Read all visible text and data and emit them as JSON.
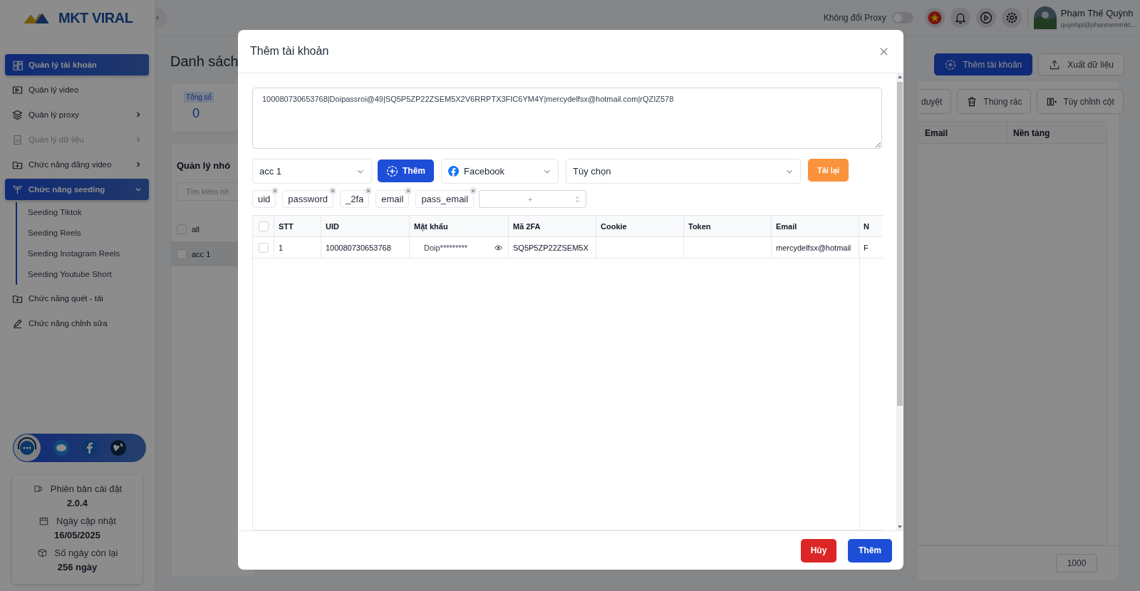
{
  "app": {
    "logo": "MKT VIRAL"
  },
  "sidebar": {
    "items": [
      {
        "label": "Quản lý tài khoản",
        "selected": true,
        "disabled": false
      },
      {
        "label": "Quản lý video",
        "selected": false,
        "disabled": false
      },
      {
        "label": "Quản lý proxy",
        "selected": false,
        "disabled": false,
        "expanded": false
      },
      {
        "label": "Quản lý dữ liệu",
        "selected": false,
        "disabled": true,
        "expanded": false
      },
      {
        "label": "Chức năng đăng video",
        "selected": false,
        "disabled": false,
        "expanded": false
      },
      {
        "label": "Chức năng seeding",
        "selected": true,
        "disabled": false,
        "expanded": true,
        "children": [
          {
            "label": "Seeding Tiktok",
            "selected": false
          },
          {
            "label": "Seeding Reels",
            "selected": false
          },
          {
            "label": "Seeding Instagram Reels",
            "selected": false
          },
          {
            "label": "Seeding Youtube Short",
            "selected": false
          }
        ]
      },
      {
        "label": "Chức năng quét - tải",
        "selected": false,
        "disabled": false
      },
      {
        "label": "Chức năng chỉnh sửa",
        "selected": false,
        "disabled": false
      }
    ],
    "install_info": [
      {
        "label": "Phiên bản cài đặt",
        "value": "2.0.4"
      },
      {
        "label": "Ngày cập nhật",
        "value": "16/05/2025"
      },
      {
        "label": "Số ngày còn lại",
        "value": "256 ngày"
      }
    ]
  },
  "header": {
    "proxy_toggle": {
      "label": "Không đổi Proxy",
      "on": false
    },
    "user": {
      "name": "Phạm Thế Quỳnh",
      "email": "quynhpt@phanmemmkt...."
    }
  },
  "page": {
    "title": "Danh sách",
    "total": {
      "label": "Tổng số",
      "value": "0"
    },
    "groups": {
      "title": "Quản lý nhó",
      "search": {
        "placeholder": "Tìm kiếm nh"
      },
      "items": [
        {
          "label": "all",
          "selected": false,
          "checked": false
        },
        {
          "label": "acc 1",
          "selected": true,
          "checked": false
        }
      ]
    },
    "actions": [
      "Thêm tài khoản",
      "Xuất dữ liệu"
    ],
    "toolbar": [
      "duyệt",
      "Thùng rác",
      "Tùy chỉnh cột"
    ],
    "columns": [
      "Email",
      "Nền tảng"
    ],
    "page_size": "1000"
  },
  "modal": {
    "title": "Thêm tài khoản",
    "input": {
      "value": "100080730653768|Doipassroi@49|SQ5P5ZP22ZSEM5X2V6RRPTX3FIC6YM4Y|mercydelfsx@hotmail.com|rQZIZ578"
    },
    "group_select": "acc 1",
    "add_button": "Thêm",
    "platform_select": "Facebook",
    "option_select": {
      "placeholder": "Tùy chọn"
    },
    "reload_button": "Tải lại",
    "fields": [
      "uid",
      "password",
      "_2fa",
      "email",
      "pass_email"
    ],
    "field_add": {
      "placeholder": "+"
    },
    "table": {
      "header_checked": false,
      "columns": [
        "STT",
        "UID",
        "Mật khẩu",
        "Mã 2FA",
        "Cookie",
        "Token",
        "Email",
        "N"
      ],
      "rows": [
        {
          "checked": false,
          "cells": [
            "1",
            "100080730653768",
            "Doip*********",
            "SQ5P5ZP22ZSEM5X",
            null,
            null,
            "mercydelfsx@hotmail",
            "F"
          ]
        }
      ]
    },
    "buttons": {
      "cancel": "Hủy",
      "submit": "Thêm"
    }
  }
}
